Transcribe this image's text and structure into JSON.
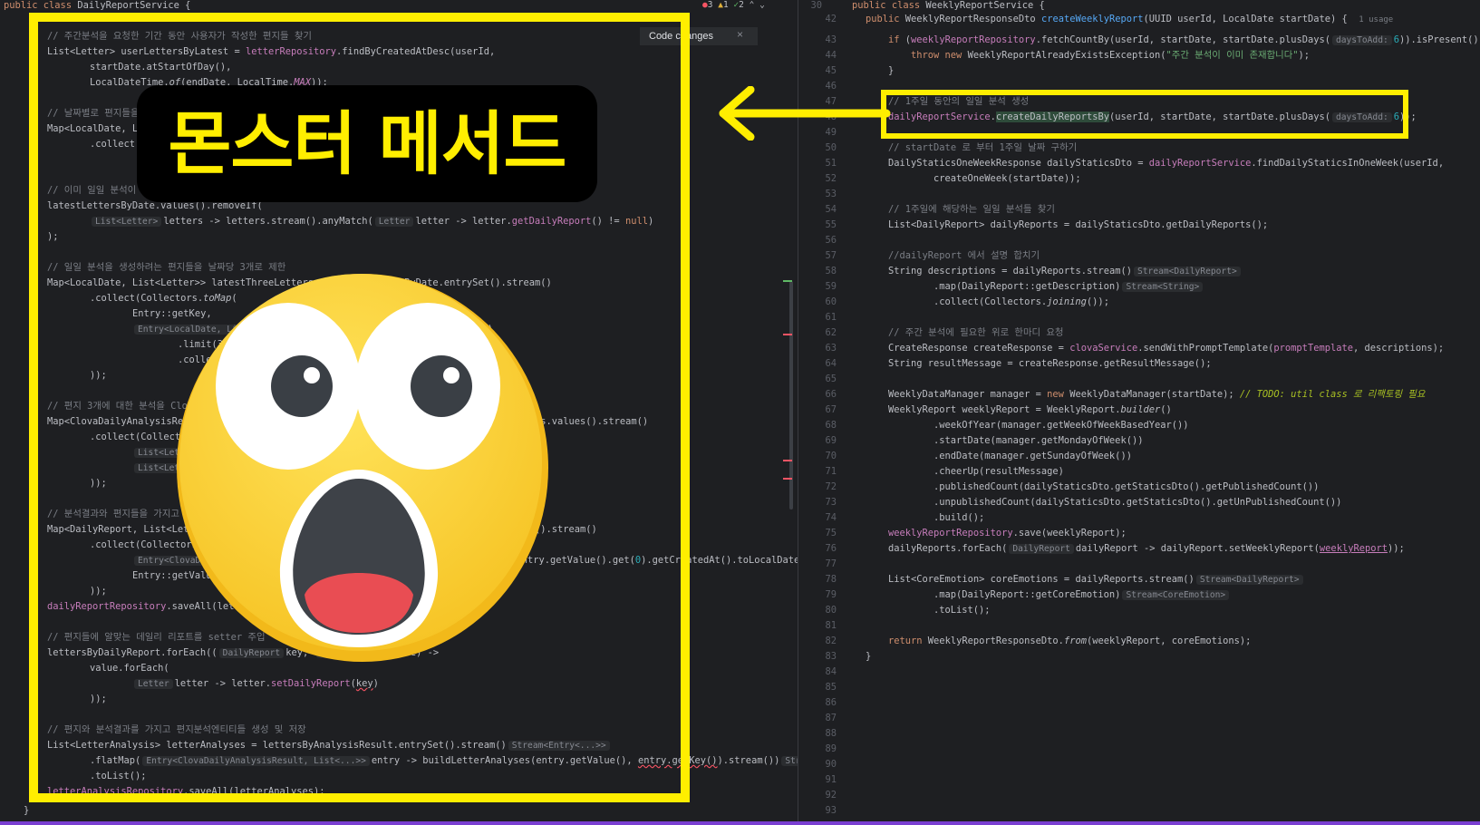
{
  "overlay": {
    "title": "몬스터 메서드",
    "emoji": "shocked-face-emoji"
  },
  "left_editor": {
    "header": "public class DailyReportService {",
    "status": {
      "errors": "3",
      "warnings": "1",
      "ok": "2"
    },
    "popup": {
      "label": "Code changes",
      "close": "×"
    }
  },
  "right_editor": {
    "header": "public class WeeklyReportService {",
    "header_line": "30"
  },
  "colors": {
    "highlight": "#ffee00",
    "background": "#1e1f22"
  }
}
